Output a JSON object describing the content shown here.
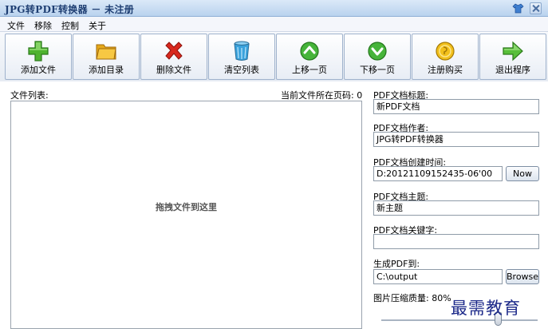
{
  "window": {
    "title": "JPG转PDF转换器 － 未注册"
  },
  "menu": [
    "文件",
    "移除",
    "控制",
    "关于"
  ],
  "toolbar": {
    "buttons": [
      {
        "label": "添加文件",
        "icon": "plus-icon"
      },
      {
        "label": "添加目录",
        "icon": "folder-icon"
      },
      {
        "label": "删除文件",
        "icon": "delete-x-icon"
      },
      {
        "label": "清空列表",
        "icon": "trash-can-icon"
      },
      {
        "label": "上移一页",
        "icon": "arrow-up-icon"
      },
      {
        "label": "下移一页",
        "icon": "arrow-down-icon"
      },
      {
        "label": "注册购买",
        "icon": "coin-icon"
      },
      {
        "label": "退出程序",
        "icon": "arrow-right-icon"
      }
    ]
  },
  "file_list": {
    "label": "文件列表:",
    "page_label": "当前文件所在页码: 0",
    "drop_hint": "拖拽文件到这里"
  },
  "fields": {
    "title_label": "PDF文档标题:",
    "title_value": "新PDF文档",
    "author_label": "PDF文档作者:",
    "author_value": "JPG转PDF转换器",
    "created_label": "PDF文档创建时间:",
    "created_value": "D:20121109152435-06'00",
    "now_button": "Now",
    "subject_label": "PDF文档主题:",
    "subject_value": "新主题",
    "keywords_label": "PDF文档关键字:",
    "keywords_value": "",
    "output_label": "生成PDF到:",
    "output_value": "C:\\output",
    "browse_button": "Browse",
    "quality_label": "图片压缩质量: 80%",
    "quality_value": 0.8
  },
  "watermark": "最需教育"
}
